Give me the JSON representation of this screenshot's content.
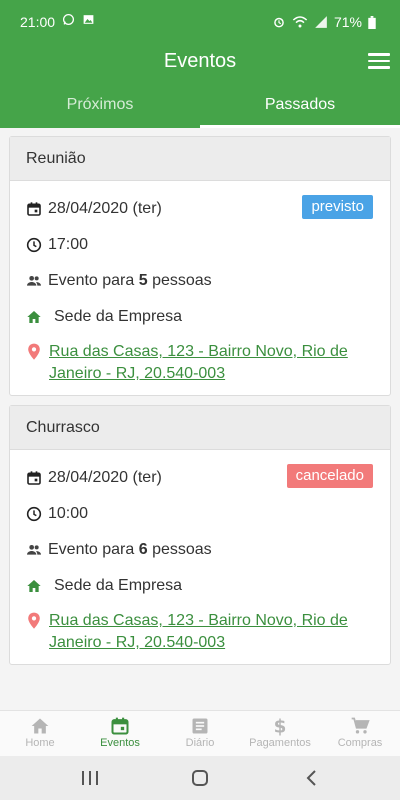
{
  "status_bar": {
    "time": "21:00",
    "battery": "71%"
  },
  "app_bar": {
    "title": "Eventos"
  },
  "tabs": [
    {
      "label": "Próximos",
      "active": false
    },
    {
      "label": "Passados",
      "active": true
    }
  ],
  "events": [
    {
      "title": "Reunião",
      "date": "28/04/2020 (ter)",
      "status": "previsto",
      "time": "17:00",
      "people_prefix": "Evento para ",
      "people_count": "5",
      "people_suffix": " pessoas",
      "place": "Sede da Empresa",
      "address": "Rua das Casas, 123 - Bairro Novo, Rio de Janeiro - RJ, 20.540-003"
    },
    {
      "title": "Churrasco",
      "date": "28/04/2020 (ter)",
      "status": "cancelado",
      "time": "10:00",
      "people_prefix": "Evento para ",
      "people_count": "6",
      "people_suffix": " pessoas",
      "place": "Sede da Empresa",
      "address": "Rua das Casas, 123 - Bairro Novo, Rio de Janeiro - RJ, 20.540-003"
    }
  ],
  "bottom_nav": [
    {
      "label": "Home",
      "icon": "home-icon",
      "active": false
    },
    {
      "label": "Eventos",
      "icon": "calendar-icon",
      "active": true
    },
    {
      "label": "Diário",
      "icon": "journal-icon",
      "active": false
    },
    {
      "label": "Pagamentos",
      "icon": "dollar-icon",
      "active": false
    },
    {
      "label": "Compras",
      "icon": "cart-icon",
      "active": false
    }
  ],
  "colors": {
    "primary": "#45a449",
    "link": "#3b8f3e",
    "badge_previsto": "#4aa3e6",
    "badge_cancelado": "#f27a7a",
    "home_icon": "#3b8f3e",
    "location_icon": "#f27a7a"
  }
}
